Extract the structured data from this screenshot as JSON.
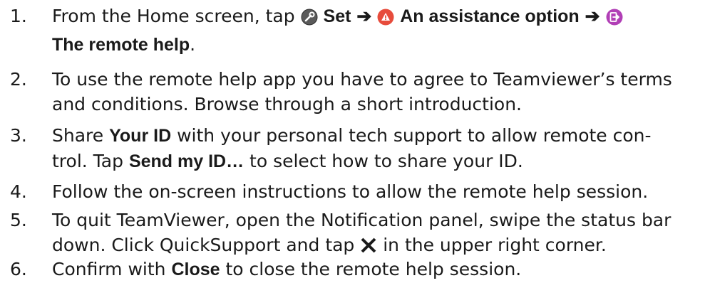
{
  "steps": [
    {
      "number": "1.",
      "text_a": "From the Home screen, tap ",
      "set_label": "Set",
      "arrow": "➔",
      "assistance_label": "An assistance option",
      "remote_help_label": "The remote help",
      "end": ".",
      "icons": {
        "settings": "settings-icon",
        "assistance": "alert-icon",
        "remote": "remote-help-icon"
      },
      "colors": {
        "settings": "#555555",
        "assistance": "#e74c3c",
        "remote": "#b13fb6"
      }
    },
    {
      "number": "2.",
      "line1": "To use the remote help app you have to agree to Teamviewer’s terms",
      "line2": "and conditions. Browse through a short introduction."
    },
    {
      "number": "3.",
      "text_a": "Share ",
      "your_id": "Your ID",
      "text_b": " with your personal tech support to allow remote con-",
      "text_c": "trol. Tap ",
      "send_id": "Send my ID…",
      "text_d": " to select how to share your ID."
    },
    {
      "number": "4.",
      "line1": "Follow the on-screen instructions to allow the remote help session."
    },
    {
      "number": "5.",
      "line1": "To quit TeamViewer, open the Notification panel, swipe the status bar",
      "text_a": "down. Click QuickSupport and tap ",
      "icon": "close-x-icon",
      "text_b": " in the upper right corner."
    },
    {
      "number": "6.",
      "text_a": "Confirm with ",
      "close_label": "Close",
      "text_b": " to close the remote help session."
    }
  ]
}
